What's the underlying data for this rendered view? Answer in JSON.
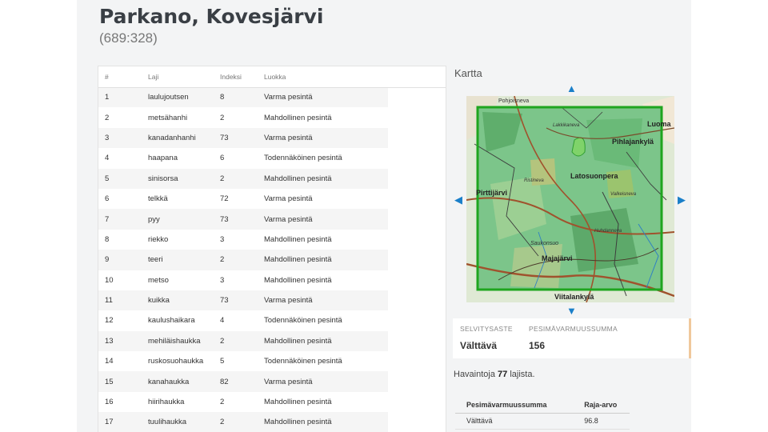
{
  "header": {
    "title": "Parkano, Kovesjärvi",
    "grid_code": "(689:328)"
  },
  "species_table": {
    "columns": [
      "#",
      "Laji",
      "Indeksi",
      "Luokka"
    ],
    "rows": [
      [
        "1",
        "laulujoutsen",
        "8",
        "Varma pesintä"
      ],
      [
        "2",
        "metsähanhi",
        "2",
        "Mahdollinen pesintä"
      ],
      [
        "3",
        "kanadanhanhi",
        "73",
        "Varma pesintä"
      ],
      [
        "4",
        "haapana",
        "6",
        "Todennäköinen pesintä"
      ],
      [
        "5",
        "sinisorsa",
        "2",
        "Mahdollinen pesintä"
      ],
      [
        "6",
        "telkkä",
        "72",
        "Varma pesintä"
      ],
      [
        "7",
        "pyy",
        "73",
        "Varma pesintä"
      ],
      [
        "8",
        "riekko",
        "3",
        "Mahdollinen pesintä"
      ],
      [
        "9",
        "teeri",
        "2",
        "Mahdollinen pesintä"
      ],
      [
        "10",
        "metso",
        "3",
        "Mahdollinen pesintä"
      ],
      [
        "11",
        "kuikka",
        "73",
        "Varma pesintä"
      ],
      [
        "12",
        "kaulushaikara",
        "4",
        "Todennäköinen pesintä"
      ],
      [
        "13",
        "mehiläishaukka",
        "2",
        "Mahdollinen pesintä"
      ],
      [
        "14",
        "ruskosuohaukka",
        "5",
        "Todennäköinen pesintä"
      ],
      [
        "15",
        "kanahaukka",
        "82",
        "Varma pesintä"
      ],
      [
        "16",
        "hiirihaukka",
        "2",
        "Mahdollinen pesintä"
      ],
      [
        "17",
        "tuulihaukka",
        "2",
        "Mahdollinen pesintä"
      ]
    ]
  },
  "map_panel": {
    "title": "Kartta",
    "place_labels": [
      "Pohjoisneva",
      "Luoma",
      "Lakkikaneva",
      "Pihlajankylä",
      "Latosuonpera",
      "Ristineva",
      "Pirttijärvi",
      "Valkeisneva",
      "Huhdanneva",
      "Saukonsuo",
      "Majajärvi",
      "Viitalankylä"
    ],
    "pan_arrows": [
      "arrow-up",
      "arrow-down",
      "arrow-left",
      "arrow-right"
    ],
    "square_color": "#1fa51f"
  },
  "status": {
    "selvitysaste_label": "SELVITYSASTE",
    "selvitysaste_value": "Välttävä",
    "summa_label": "PESIMÄVARMUUSSUMMA",
    "summa_value": "156"
  },
  "observations": {
    "prefix": "Havaintoja",
    "count": "77",
    "suffix": "lajista."
  },
  "threshold_table": {
    "columns": [
      "Pesimävarmuussumma",
      "Raja-arvo"
    ],
    "rows": [
      [
        "Välttävä",
        "96.8"
      ]
    ]
  }
}
